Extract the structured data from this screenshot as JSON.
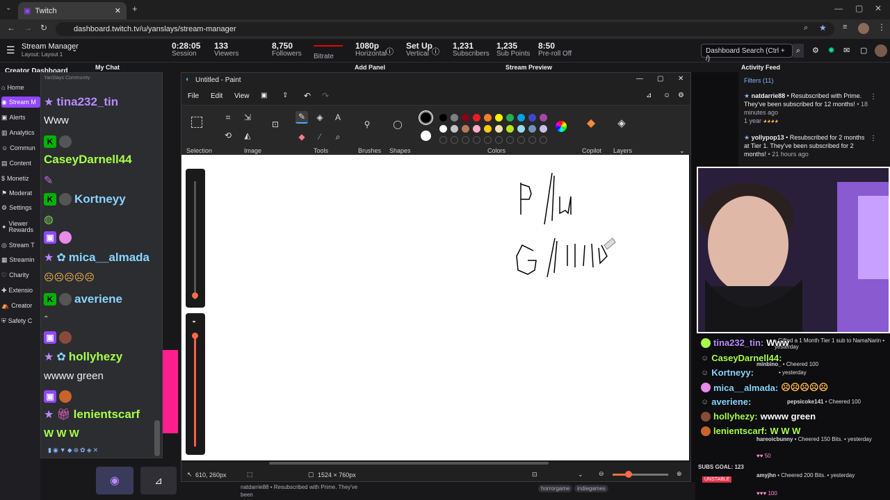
{
  "browser": {
    "tab_title": "Twitch",
    "url": "dashboard.twitch.tv/u/yanslays/stream-manager"
  },
  "header": {
    "title": "Stream Manager",
    "subtitle": "Layout: Layout 1",
    "stats": [
      {
        "value": "0:28:05",
        "label": "Session"
      },
      {
        "value": "133",
        "label": "Viewers"
      },
      {
        "value": "8,750",
        "label": "Followers"
      },
      {
        "value": "",
        "label": "Bitrate"
      },
      {
        "value": "1080p",
        "label": "Horizontal"
      },
      {
        "value": "Set Up",
        "label": "Vertical"
      },
      {
        "value": "1,231",
        "label": "Subscribers"
      },
      {
        "value": "1,235",
        "label": "Sub Points"
      },
      {
        "value": "8:50",
        "label": "Pre-roll Off"
      }
    ],
    "search_placeholder": "Dashboard Search (Ctrl + /)"
  },
  "panels": {
    "creator": "Creator Dashboard",
    "my_chat": "My Chat",
    "add_panel": "Add Panel",
    "stream_preview": "Stream Preview",
    "activity": "Activity Feed",
    "filters": "Filters (11)"
  },
  "sidebar": [
    "Home",
    "Stream M",
    "Alerts",
    "Analytics",
    "Commun",
    "Content",
    "Monetiz",
    "Moderat",
    "Settings",
    "Viewer Rewards",
    "Stream T",
    "Streamin",
    "Charity",
    "Extensio",
    "Creator",
    "Safety C"
  ],
  "chat": {
    "community": "YanSlays Community",
    "lines": [
      {
        "name": "tina232_tin",
        "color": "#b98aff"
      },
      {
        "msg": "Www"
      },
      {
        "name": "CaseyDarnell44",
        "color": "#a8ff4a"
      },
      {
        "name": "Kortneyy",
        "color": "#8ad4ff"
      },
      {
        "name": "mica__almada",
        "color": "#8ad4ff"
      },
      {
        "name": "averiene",
        "color": "#8ad4ff"
      },
      {
        "name": "hollyhezy",
        "color": "#a8ff4a"
      },
      {
        "msg": "wwww green"
      },
      {
        "name": "lenientscarf",
        "color": "#a8ff4a"
      },
      {
        "msg": "W W W"
      }
    ]
  },
  "paint": {
    "title": "Untitled - Paint",
    "menu": [
      "File",
      "Edit",
      "View"
    ],
    "groups": [
      "Selection",
      "Image",
      "Tools",
      "Brushes",
      "Shapes",
      "Colors",
      "Copilot",
      "Layers"
    ],
    "status_pos": "610, 260px",
    "status_size": "1524 × 760px",
    "drawing": [
      "P/M",
      "G/W"
    ]
  },
  "activity": [
    {
      "user": "natdarrie88",
      "text": "• Resubscribed with Prime. They've been subscribed for 12 months!",
      "time": "• 18 minutes ago",
      "extra": "1 year"
    },
    {
      "user": "yollypop13",
      "text": "• Resubscribed for 2 months at Tier 1. They've been subscribed for 2 months!",
      "time": "• 21 hours ago"
    }
  ],
  "overlay": [
    {
      "name": "tina232_tin:",
      "msg": "Www",
      "color": "#b98aff"
    },
    {
      "name": "CaseyDarnell44:",
      "msg": "",
      "color": "#a8ff4a"
    },
    {
      "name": "Kortneyy:",
      "msg": "",
      "color": "#8ad4ff"
    },
    {
      "name": "mica__almada:",
      "msg": "",
      "color": "#8ad4ff"
    },
    {
      "name": "averiene:",
      "msg": "",
      "color": "#8ad4ff"
    },
    {
      "name": "hollyhezy:",
      "msg": "wwww green",
      "color": "#a8ff4a"
    },
    {
      "name": "lenientscarf:",
      "msg": "W W W",
      "color": "#a8ff4a"
    }
  ],
  "feed_bottom": [
    {
      "text": "• Gifted a 1 Month Tier 1 sub to NamaNarin • yesterday"
    },
    {
      "user": "minbino_",
      "text": "• Cheered 100",
      "time": "• yesterday"
    },
    {
      "user": "pepsicoke141",
      "text": "• Cheered 100",
      "time": "• yesterday"
    },
    {
      "user": "hareoicbunny",
      "text": "• Cheered 150 Bits.",
      "time": "• yesterday",
      "extra": "50"
    },
    {
      "user": "amyjhn",
      "text": "• Cheered 200 Bits.",
      "time": "• yesterday",
      "extra": "100"
    }
  ],
  "misc": {
    "subs_goal": "SUBS GOAL: 123",
    "unstable": "UNSTABLE",
    "bottom_feed": "natdarrie88 • Resubscribed with Prime. They've been",
    "tags": [
      "horrorgame",
      "indiegames"
    ]
  }
}
